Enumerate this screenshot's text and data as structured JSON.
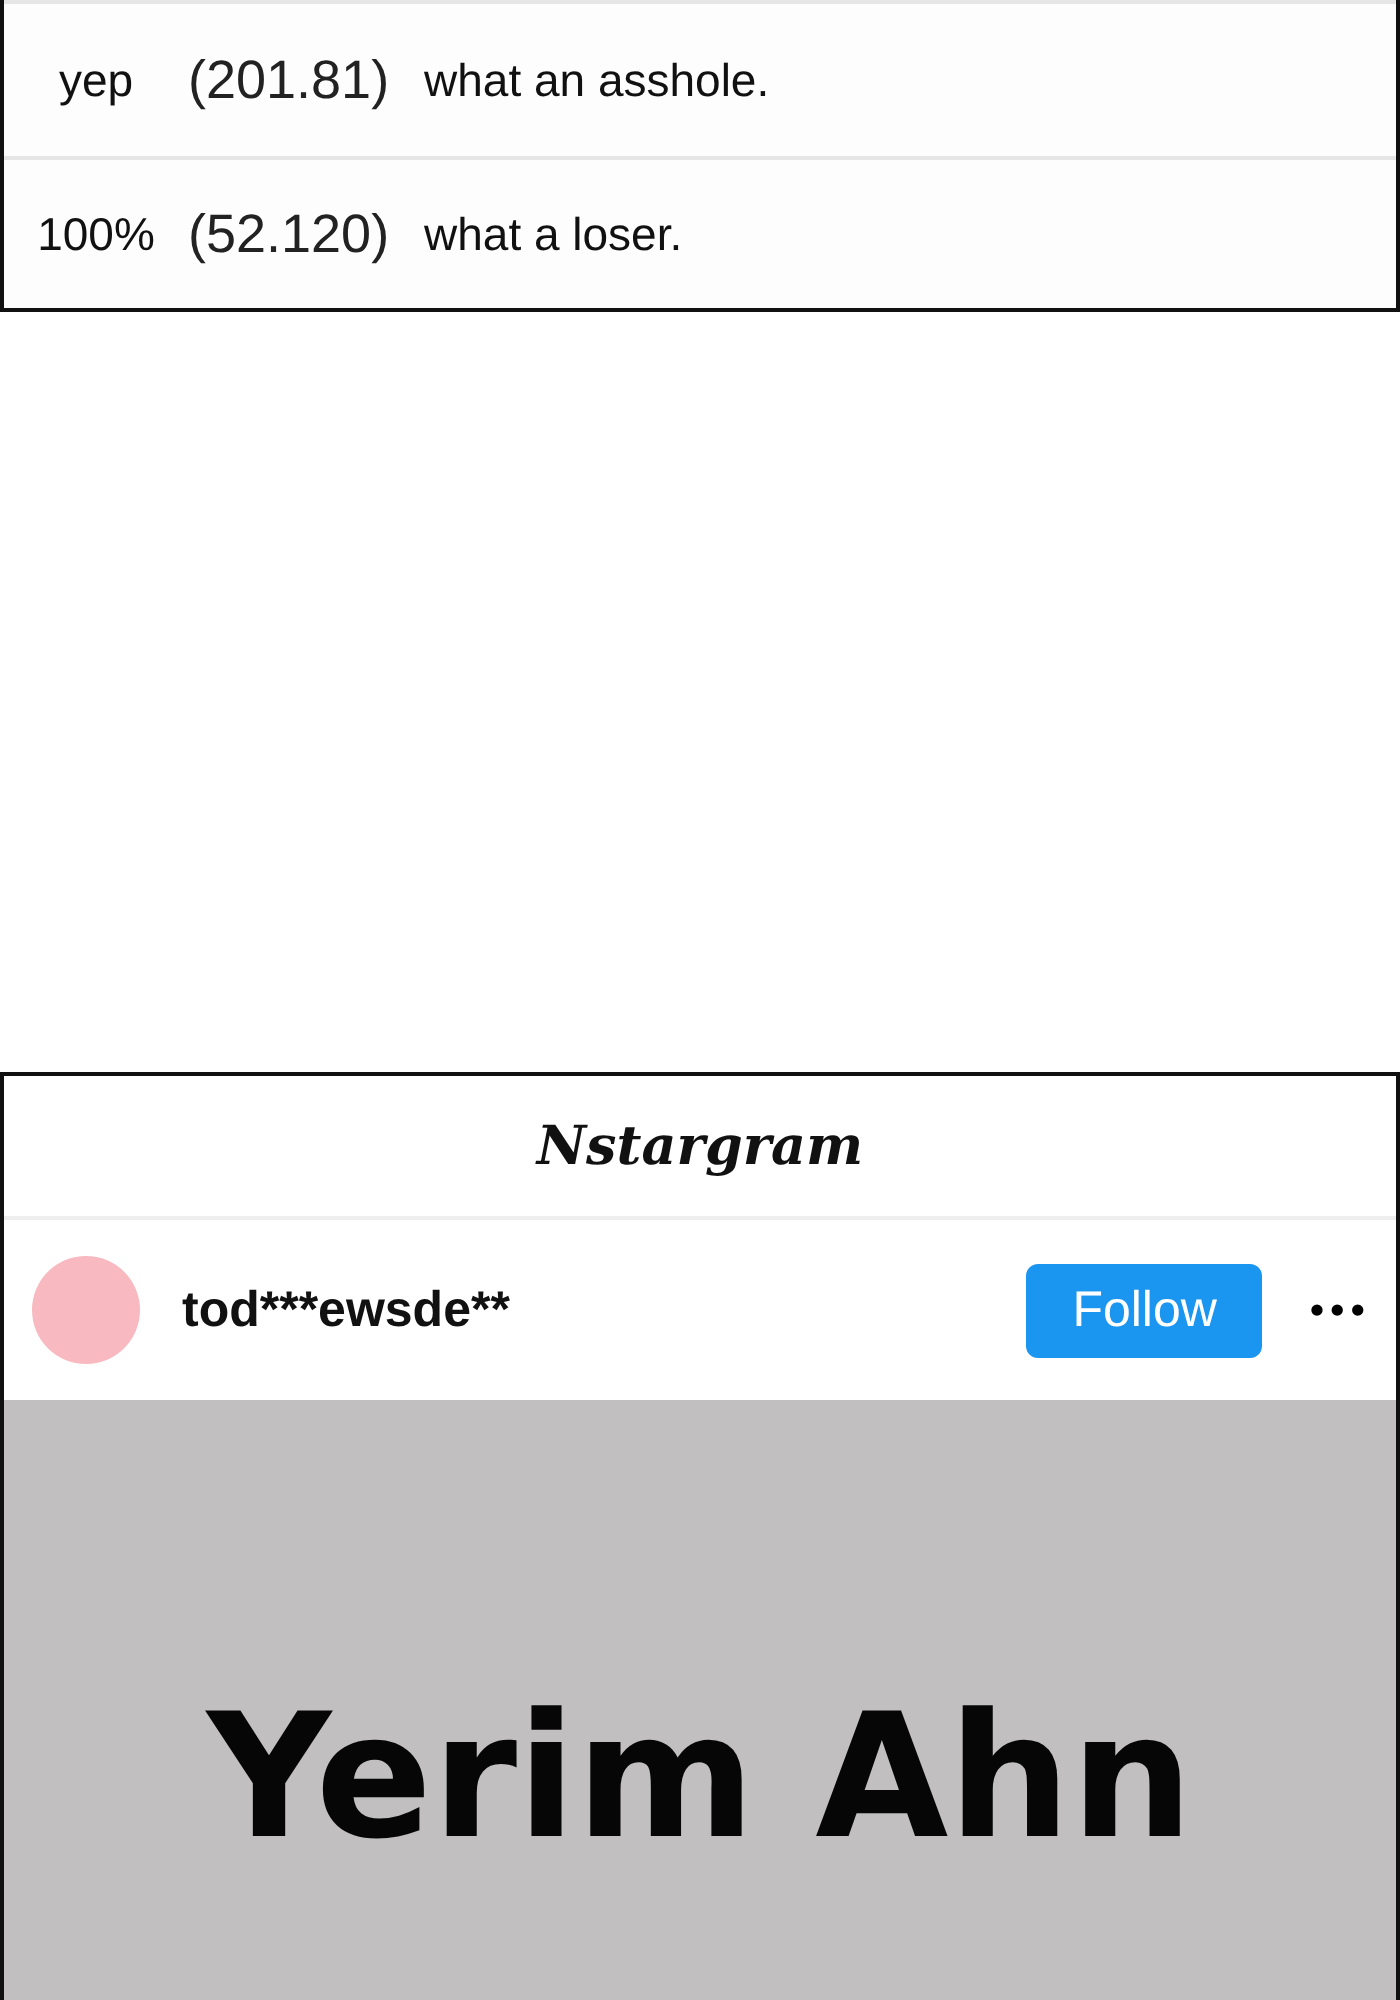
{
  "comments": [
    {
      "label": "yep",
      "score": "(201.81)",
      "text": "what an asshole."
    },
    {
      "label": "100%",
      "score": "(52.120)",
      "text": "what a loser."
    }
  ],
  "post": {
    "app_title": "Nstargram",
    "username": "tod***ewsde**",
    "follow_button": "Follow",
    "more_button": "•••",
    "image_text": [
      "Yerim Ahn"
    ]
  }
}
